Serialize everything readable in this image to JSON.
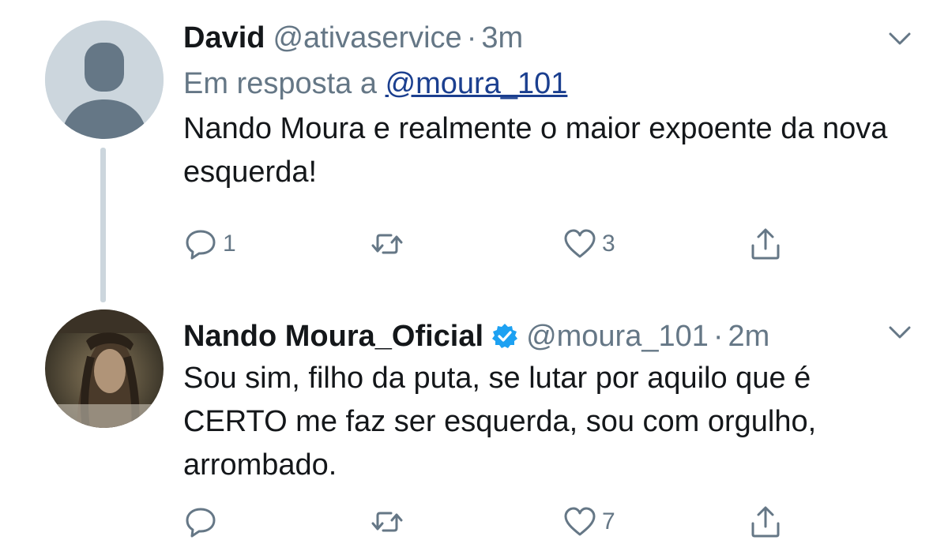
{
  "tweets": [
    {
      "name": "David",
      "handle": "@ativaservice",
      "separator": "·",
      "time": "3m",
      "reply_prefix": "Em resposta a",
      "reply_mention": "@moura_101",
      "text": "Nando Moura e realmente o maior expoente da nova esquerda!",
      "replies": "1",
      "retweets": "",
      "likes": "3",
      "avatar_icon": "default-avatar-icon"
    },
    {
      "name": "Nando Moura_Oficial",
      "verified": true,
      "handle": "@moura_101",
      "separator": "·",
      "time": "2m",
      "text": "Sou sim, filho da puta, se lutar por aquilo que é CERTO me faz ser esquerda, sou com orgulho, arrombado.",
      "replies": "",
      "retweets": "",
      "likes": "7",
      "avatar_icon": "profile-photo"
    }
  ],
  "colors": {
    "text": "#14171a",
    "secondary": "#657786",
    "verified": "#1da1f2",
    "link": "#1b3f8f",
    "thread_line": "#ccd6dd"
  }
}
